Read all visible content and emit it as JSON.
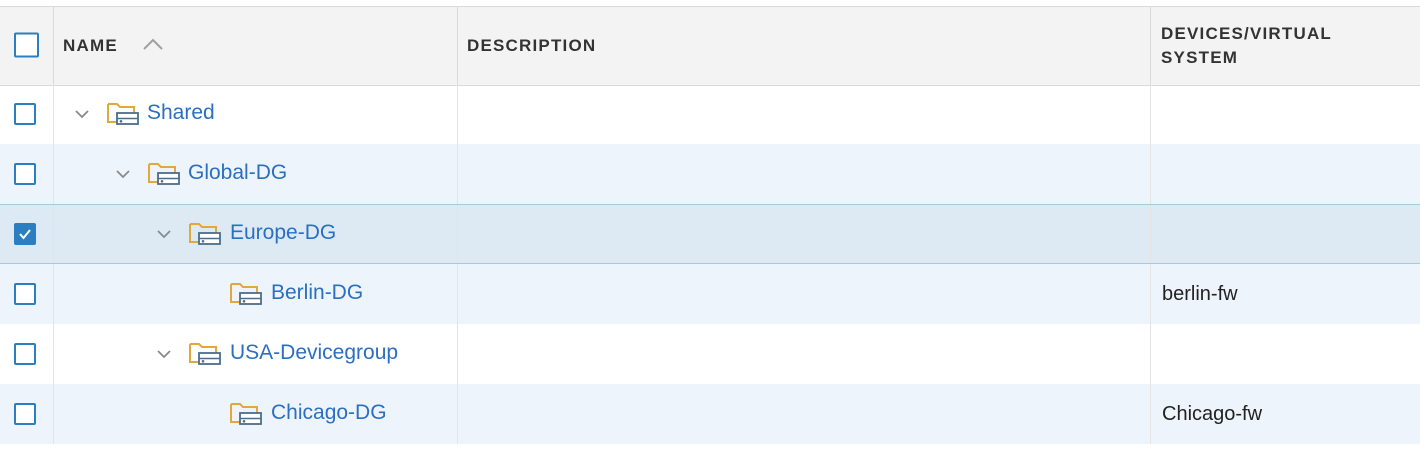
{
  "columns": {
    "name": "NAME",
    "description": "DESCRIPTION",
    "devices_line1": "DEVICES/VIRTUAL",
    "devices_line2": "SYSTEM"
  },
  "rows": [
    {
      "name": "Shared",
      "description": "",
      "devices": "",
      "checked": false,
      "expanded": true
    },
    {
      "name": "Global-DG",
      "description": "",
      "devices": "",
      "checked": false,
      "expanded": true
    },
    {
      "name": "Europe-DG",
      "description": "",
      "devices": "",
      "checked": true,
      "expanded": true
    },
    {
      "name": "Berlin-DG",
      "description": "",
      "devices": "berlin-fw",
      "checked": false,
      "expanded": false
    },
    {
      "name": "USA-Devicegroup",
      "description": "",
      "devices": "",
      "checked": false,
      "expanded": true
    },
    {
      "name": "Chicago-DG",
      "description": "",
      "devices": "Chicago-fw",
      "checked": false,
      "expanded": false
    }
  ],
  "icons": {
    "folder": "device-group-folder-icon",
    "chevron": "chevron-down-icon",
    "sort": "sort-ascending-icon"
  },
  "colors": {
    "accent": "#2b7fc0",
    "link": "#2a6fc1",
    "folder": "#e0a93a",
    "selected_row": "#ddeaf4",
    "alt_row": "#eef4fb"
  }
}
